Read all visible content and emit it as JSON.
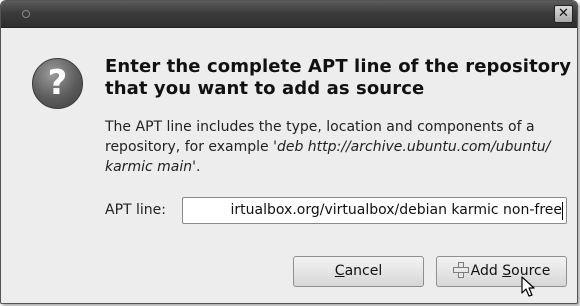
{
  "window": {
    "close_glyph": "✕"
  },
  "dialog": {
    "icon_glyph": "?",
    "heading": "Enter the complete APT line of the repository that you want to add as source",
    "description_prefix": "The APT line includes the type, location and components of a repository, for example  '",
    "description_example": "deb http://archive.ubuntu.com/ubuntu/ karmic main",
    "description_suffix": "'.",
    "apt_label": "APT line:",
    "apt_value": "irtualbox.org/virtualbox/debian karmic non-free"
  },
  "buttons": {
    "cancel_mnemonic": "C",
    "cancel_rest": "ancel",
    "add_prefix": "Add ",
    "add_mnemonic": "S",
    "add_rest": "ource"
  },
  "icons": {
    "question": "question-icon",
    "close": "close-icon",
    "add": "plus-icon",
    "cursor": "mouse-pointer-icon"
  }
}
